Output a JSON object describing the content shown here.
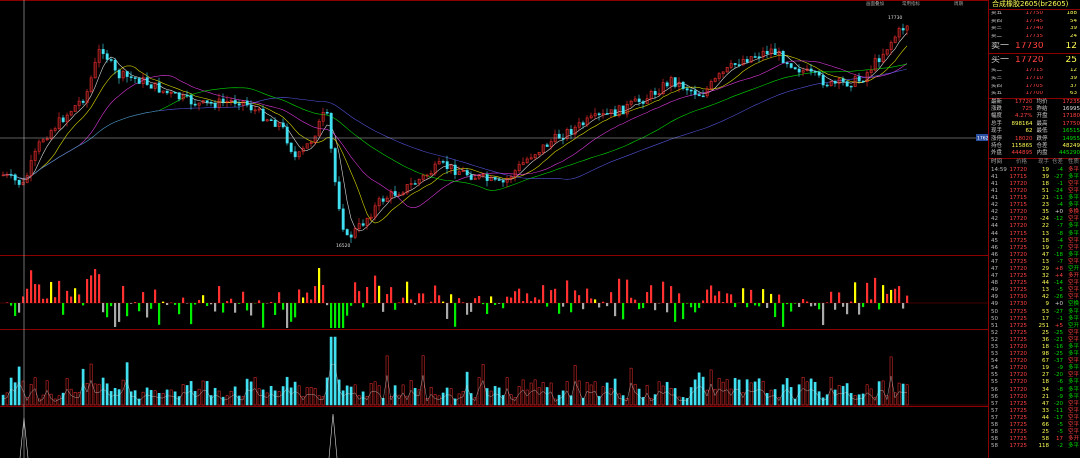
{
  "toolbar": {
    "links": [
      "画面叠加",
      "常用指标",
      "周期"
    ]
  },
  "price_axis_tag": "17620",
  "annotations": {
    "high": "17730",
    "low": "16520"
  },
  "colors": {
    "up": "#ff3030",
    "down": "#40e0f0",
    "bg": "#000000",
    "border": "#8b0000",
    "ma1": "#ffffff",
    "ma2": "#ffff00",
    "ma3": "#ff40ff",
    "ma4": "#00ff00"
  },
  "side": {
    "title": "合成橡胶2605(br2605)",
    "asks": [
      {
        "label": "卖五",
        "price": "17750",
        "vol": "188"
      },
      {
        "label": "卖四",
        "price": "17745",
        "vol": "54"
      },
      {
        "label": "卖三",
        "price": "17740",
        "vol": "39"
      },
      {
        "label": "卖二",
        "price": "17735",
        "vol": "24"
      }
    ],
    "ask1": {
      "label": "卖一",
      "price": "17730",
      "vol": "12"
    },
    "bid1": {
      "label": "买一",
      "price": "17720",
      "vol": "25"
    },
    "bids": [
      {
        "label": "买二",
        "price": "17715",
        "vol": "12"
      },
      {
        "label": "买三",
        "price": "17710",
        "vol": "39"
      },
      {
        "label": "买四",
        "price": "17705",
        "vol": "37"
      },
      {
        "label": "买五",
        "price": "17700",
        "vol": "63"
      }
    ],
    "stats": [
      {
        "k1": "最新",
        "v1": "17720",
        "c1": "red",
        "k2": "均价",
        "v2": "17235",
        "c2": "red"
      },
      {
        "k1": "涨跌",
        "v1": "725",
        "c1": "red",
        "k2": "昨结",
        "v2": "16995",
        "c2": "wht"
      },
      {
        "k1": "幅度",
        "v1": "4.27%",
        "c1": "red",
        "k2": "开盘",
        "v2": "17180",
        "c2": "red"
      },
      {
        "k1": "总手",
        "v1": "898164",
        "c1": "yel",
        "k2": "最高",
        "v2": "17750",
        "c2": "red"
      },
      {
        "k1": "现手",
        "v1": "62",
        "c1": "yel",
        "k2": "最低",
        "v2": "16515",
        "c2": "grn"
      },
      {
        "k1": "涨停",
        "v1": "18020",
        "c1": "red",
        "k2": "跌停",
        "v2": "14955",
        "c2": "grn"
      },
      {
        "k1": "持仓",
        "v1": "115865",
        "c1": "yel",
        "k2": "仓差",
        "v2": "48249",
        "c2": "yel"
      },
      {
        "k1": "外盘",
        "v1": "444895",
        "c1": "red",
        "k2": "内盘",
        "v2": "445290",
        "c2": "grn"
      }
    ],
    "tick_header": [
      "时间",
      "价格",
      "现手",
      "仓差",
      "性质"
    ],
    "ticks": [
      {
        "t": "14:59",
        "p": "17720",
        "v": "19",
        "d": "-4",
        "n": "多平",
        "pc": "red",
        "dc": "grn",
        "nc": "red"
      },
      {
        "t": "41",
        "p": "17715",
        "v": "39",
        "d": "-27",
        "pc": "red",
        "dc": "grn",
        "n": "多平",
        "nc": "grn"
      },
      {
        "t": "41",
        "p": "17720",
        "v": "18",
        "d": "-1",
        "pc": "red",
        "dc": "grn",
        "n": "空平",
        "nc": "red"
      },
      {
        "t": "41",
        "p": "17720",
        "v": "51",
        "d": "-24",
        "pc": "red",
        "dc": "grn",
        "n": "空平",
        "nc": "red"
      },
      {
        "t": "41",
        "p": "17715",
        "v": "21",
        "d": "-11",
        "pc": "red",
        "dc": "grn",
        "n": "多平",
        "nc": "grn"
      },
      {
        "t": "42",
        "p": "17715",
        "v": "23",
        "d": "-4",
        "pc": "red",
        "dc": "grn",
        "n": "多平",
        "nc": "grn"
      },
      {
        "t": "42",
        "p": "17720",
        "v": "35",
        "d": "+0",
        "pc": "red",
        "dc": "wht",
        "n": "多换",
        "nc": "red"
      },
      {
        "t": "42",
        "p": "17720",
        "v": "-24",
        "d": "-12",
        "pc": "red",
        "dc": "grn",
        "n": "空平",
        "nc": "red"
      },
      {
        "t": "44",
        "p": "17720",
        "v": "22",
        "d": "-7",
        "pc": "red",
        "dc": "grn",
        "n": "多平",
        "nc": "grn"
      },
      {
        "t": "44",
        "p": "17715",
        "v": "13",
        "d": "-8",
        "pc": "red",
        "dc": "grn",
        "n": "多平",
        "nc": "grn"
      },
      {
        "t": "45",
        "p": "17725",
        "v": "18",
        "d": "-4",
        "pc": "red",
        "dc": "grn",
        "n": "空平",
        "nc": "red"
      },
      {
        "t": "46",
        "p": "17725",
        "v": "19",
        "d": "-7",
        "pc": "red",
        "dc": "grn",
        "n": "空平",
        "nc": "red"
      },
      {
        "t": "46",
        "p": "17720",
        "v": "47",
        "d": "-18",
        "pc": "red",
        "dc": "grn",
        "n": "多平",
        "nc": "grn"
      },
      {
        "t": "47",
        "p": "17725",
        "v": "13",
        "d": "-7",
        "pc": "red",
        "dc": "grn",
        "n": "空平",
        "nc": "red"
      },
      {
        "t": "47",
        "p": "17720",
        "v": "29",
        "d": "+8",
        "pc": "red",
        "dc": "red",
        "n": "空开",
        "nc": "grn"
      },
      {
        "t": "47",
        "p": "17725",
        "v": "32",
        "d": "+4",
        "pc": "red",
        "dc": "red",
        "n": "多开",
        "nc": "red"
      },
      {
        "t": "48",
        "p": "17725",
        "v": "44",
        "d": "-14",
        "pc": "red",
        "dc": "grn",
        "n": "空平",
        "nc": "red"
      },
      {
        "t": "49",
        "p": "17725",
        "v": "13",
        "d": "-5",
        "pc": "red",
        "dc": "grn",
        "n": "空平",
        "nc": "red"
      },
      {
        "t": "49",
        "p": "17730",
        "v": "42",
        "d": "-26",
        "pc": "red",
        "dc": "grn",
        "n": "空平",
        "nc": "red"
      },
      {
        "t": "49",
        "p": "17730",
        "v": "9",
        "d": "+0",
        "pc": "red",
        "dc": "wht",
        "n": "空换",
        "nc": "grn"
      },
      {
        "t": "50",
        "p": "17725",
        "v": "53",
        "d": "-27",
        "pc": "red",
        "dc": "grn",
        "n": "多平",
        "nc": "grn"
      },
      {
        "t": "50",
        "p": "17725",
        "v": "17",
        "d": "-1",
        "pc": "red",
        "dc": "grn",
        "n": "多平",
        "nc": "grn"
      },
      {
        "t": "51",
        "p": "17725",
        "v": "251",
        "d": "+5",
        "pc": "red",
        "dc": "red",
        "n": "空开",
        "nc": "grn"
      },
      {
        "t": "52",
        "p": "17725",
        "v": "25",
        "d": "-25",
        "pc": "red",
        "dc": "grn",
        "n": "空平",
        "nc": "red"
      },
      {
        "t": "52",
        "p": "17725",
        "v": "36",
        "d": "-21",
        "pc": "red",
        "dc": "grn",
        "n": "空平",
        "nc": "red"
      },
      {
        "t": "53",
        "p": "17720",
        "v": "18",
        "d": "-16",
        "pc": "red",
        "dc": "grn",
        "n": "多平",
        "nc": "grn"
      },
      {
        "t": "53",
        "p": "17720",
        "v": "98",
        "d": "-25",
        "pc": "red",
        "dc": "grn",
        "n": "多平",
        "nc": "grn"
      },
      {
        "t": "54",
        "p": "17720",
        "v": "67",
        "d": "-37",
        "pc": "red",
        "dc": "grn",
        "n": "空平",
        "nc": "red"
      },
      {
        "t": "54",
        "p": "17720",
        "v": "19",
        "d": "-9",
        "pc": "red",
        "dc": "grn",
        "n": "多平",
        "nc": "grn"
      },
      {
        "t": "55",
        "p": "17720",
        "v": "27",
        "d": "-20",
        "pc": "red",
        "dc": "grn",
        "n": "空平",
        "nc": "red"
      },
      {
        "t": "55",
        "p": "17720",
        "v": "18",
        "d": "-6",
        "pc": "red",
        "dc": "grn",
        "n": "多平",
        "nc": "grn"
      },
      {
        "t": "56",
        "p": "17720",
        "v": "34",
        "d": "-8",
        "pc": "red",
        "dc": "grn",
        "n": "多平",
        "nc": "grn"
      },
      {
        "t": "56",
        "p": "17720",
        "v": "21",
        "d": "-9",
        "pc": "red",
        "dc": "grn",
        "n": "多平",
        "nc": "grn"
      },
      {
        "t": "57",
        "p": "17725",
        "v": "47",
        "d": "-20",
        "pc": "red",
        "dc": "grn",
        "n": "空平",
        "nc": "red"
      },
      {
        "t": "57",
        "p": "17725",
        "v": "33",
        "d": "-11",
        "pc": "red",
        "dc": "grn",
        "n": "空平",
        "nc": "red"
      },
      {
        "t": "57",
        "p": "17725",
        "v": "44",
        "d": "-17",
        "pc": "red",
        "dc": "grn",
        "n": "空平",
        "nc": "red"
      },
      {
        "t": "58",
        "p": "17725",
        "v": "66",
        "d": "-5",
        "pc": "red",
        "dc": "grn",
        "n": "空平",
        "nc": "red"
      },
      {
        "t": "58",
        "p": "17725",
        "v": "25",
        "d": "-5",
        "pc": "red",
        "dc": "grn",
        "n": "空平",
        "nc": "red"
      },
      {
        "t": "58",
        "p": "17725",
        "v": "58",
        "d": "17",
        "pc": "red",
        "dc": "red",
        "n": "多开",
        "nc": "red"
      },
      {
        "t": "58",
        "p": "17725",
        "v": "118",
        "d": "-2",
        "pc": "red",
        "dc": "grn",
        "n": "多平",
        "nc": "grn"
      }
    ]
  }
}
